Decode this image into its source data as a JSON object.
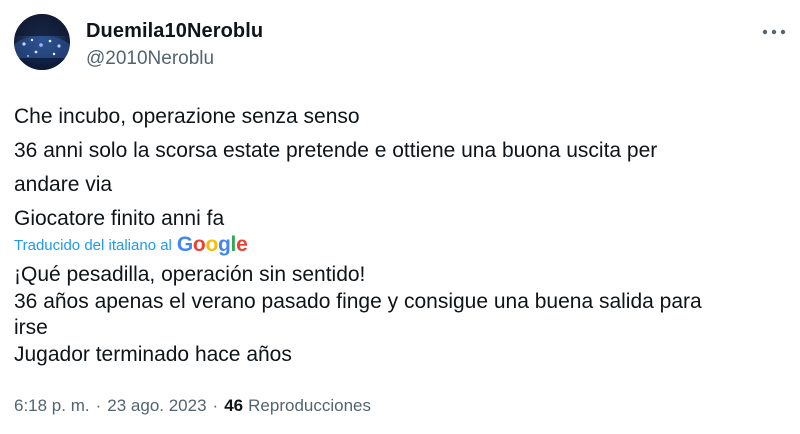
{
  "author": {
    "display_name": "Duemila10Neroblu",
    "handle": "@2010Neroblu"
  },
  "post": {
    "original_lines": [
      "Che incubo, operazione senza senso",
      "36 anni solo la scorsa estate pretende e ottiene una buona uscita per",
      "andare via",
      "Giocatore finito anni fa"
    ],
    "translation_label": "Traducido del italiano al",
    "translation_provider": "Google",
    "translated_lines": [
      "¡Qué pesadilla, operación sin sentido!",
      "36 años apenas el verano pasado finge y consigue una buena salida para",
      "irse",
      "Jugador terminado hace años"
    ]
  },
  "meta": {
    "time": "6:18 p. m.",
    "separator": "·",
    "date": "23 ago. 2023",
    "views_count": "46",
    "views_label": "Reproducciones"
  },
  "icons": {
    "more": "more-horizontal-icon"
  },
  "colors": {
    "text": "#0f1419",
    "secondary": "#536471",
    "link": "#1d9bf0",
    "google_blue": "#4285F4",
    "google_red": "#EA4335",
    "google_yellow": "#FBBC05",
    "google_green": "#34A853"
  }
}
